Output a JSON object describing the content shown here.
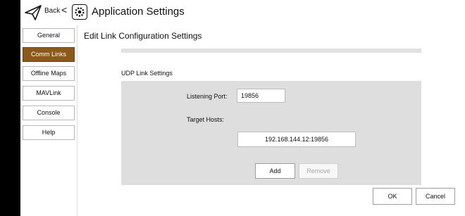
{
  "header": {
    "back_label": "Back",
    "back_arrow": "<",
    "title": "Application Settings",
    "logo_icon": "paper-plane-icon",
    "settings_icon": "gear-icon"
  },
  "sidebar": {
    "items": [
      {
        "label": "General",
        "active": false
      },
      {
        "label": "Comm Links",
        "active": true
      },
      {
        "label": "Offline Maps",
        "active": false
      },
      {
        "label": "MAVLink",
        "active": false
      },
      {
        "label": "Console",
        "active": false
      },
      {
        "label": "Help",
        "active": false
      }
    ],
    "active_color": "#8b5a1b"
  },
  "main": {
    "title": "Edit Link Configuration Settings",
    "section_label": "UDP Link Settings",
    "listening_port_label": "Listening Port:",
    "listening_port_value": "19856",
    "target_hosts_label": "Target Hosts:",
    "target_hosts": [
      "192.168.144.12:19856"
    ],
    "add_label": "Add",
    "remove_label": "Remove"
  },
  "footer": {
    "ok_label": "OK",
    "cancel_label": "Cancel"
  }
}
